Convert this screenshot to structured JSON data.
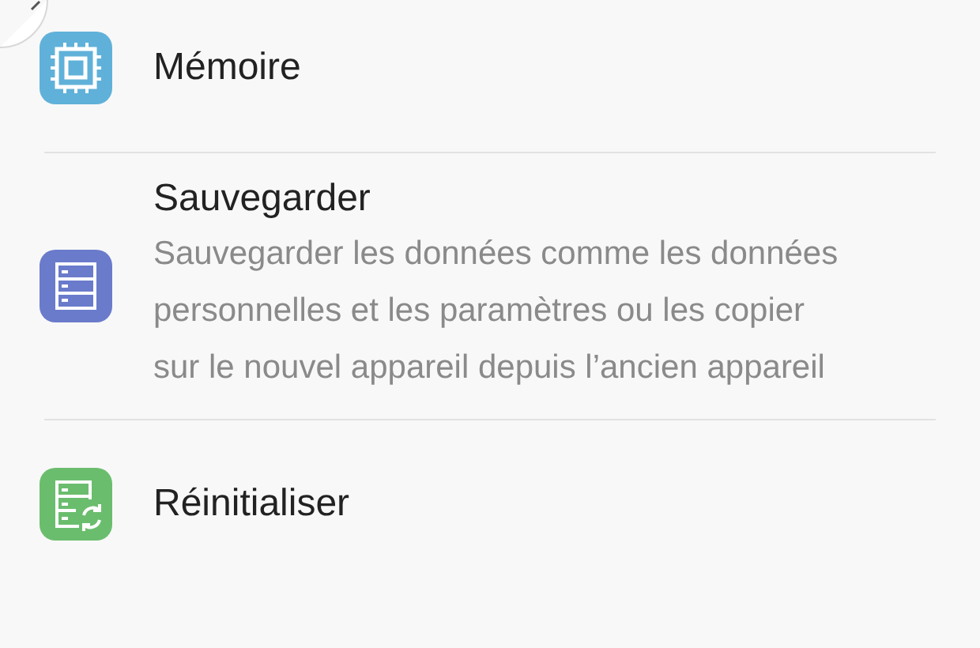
{
  "items": [
    {
      "title": "Mémoire",
      "color": "#60b1d9"
    },
    {
      "title": "Sauvegarder",
      "description": "Sauvegarder les données comme les données personnelles et les paramètres ou les copier sur le nouvel appareil depuis l’ancien appareil",
      "color": "#6a7bcb"
    },
    {
      "title": "Réinitialiser",
      "color": "#6bbd6e"
    }
  ]
}
